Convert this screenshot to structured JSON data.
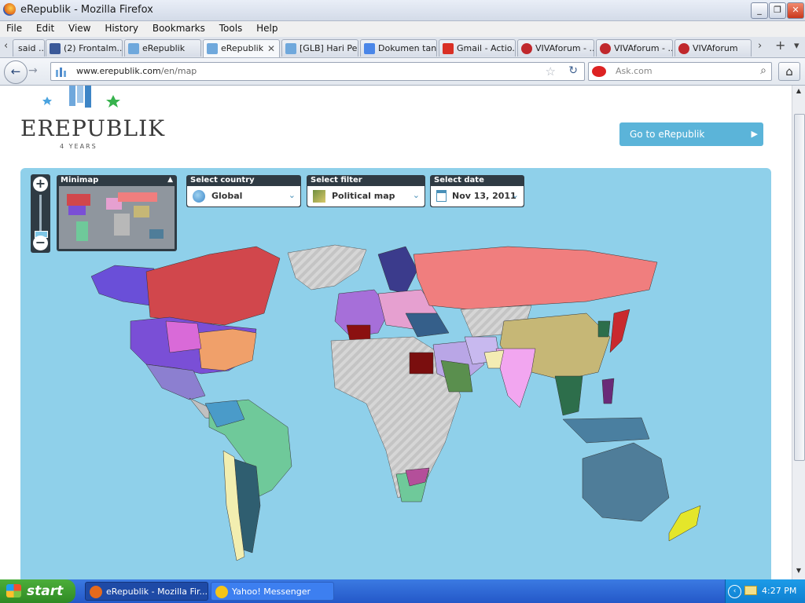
{
  "window": {
    "title": "eRepublik - Mozilla Firefox",
    "minimize": "_",
    "maximize": "❐",
    "close": "✕"
  },
  "menu": [
    "File",
    "Edit",
    "View",
    "History",
    "Bookmarks",
    "Tools",
    "Help"
  ],
  "tabs": [
    {
      "label": "said ...",
      "icon_color": "#c8c8c8"
    },
    {
      "label": "(2) Frontalm...",
      "icon_color": "#3b5998"
    },
    {
      "label": "eRepublik",
      "icon_color": "#6fa8dc"
    },
    {
      "label": "eRepublik",
      "icon_color": "#6fa8dc",
      "active": true
    },
    {
      "label": "[GLB] Hari Pe...",
      "icon_color": "#6fa8dc"
    },
    {
      "label": "Dokumen tan...",
      "icon_color": "#4a86e8"
    },
    {
      "label": "Gmail - Actio...",
      "icon_color": "#d93025"
    },
    {
      "label": "VIVAforum - ...",
      "icon_color": "#c0282c"
    },
    {
      "label": "VIVAforum - ...",
      "icon_color": "#c0282c"
    },
    {
      "label": "VIVAforum",
      "icon_color": "#c0282c"
    }
  ],
  "tab_controls": {
    "scroll_left": "‹",
    "scroll_right": "›",
    "new_tab": "+",
    "list_all": "▾",
    "close_tab": "✕"
  },
  "nav": {
    "back": "←",
    "forward": "→",
    "url_host": "www.erepublik.com",
    "url_path": "/en/map",
    "bookmark_star": "☆",
    "reload": "↻",
    "search_placeholder": "Ask.com",
    "search_icon": "⌕",
    "home": "⌂"
  },
  "page": {
    "logo_text": "EREPUBLIK",
    "logo_sub": "4 YEARS",
    "go_button": "Go to eRepublik",
    "go_chevron": "▶",
    "zoom": {
      "in": "+",
      "out": "−"
    },
    "minimap": {
      "title": "Minimap",
      "collapse": "▲"
    },
    "country_select": {
      "label": "Select country",
      "value": "Global",
      "dropdown": "⌄"
    },
    "filter_select": {
      "label": "Select filter",
      "value": "Political map",
      "dropdown": "⌄"
    },
    "date_select": {
      "label": "Select date",
      "value": "Nov 13, 2011",
      "dropdown": "⌄"
    }
  },
  "colors": {
    "ocean": "#8fd0ea",
    "button": "#5bb4d9",
    "panel": "#2f3b44",
    "accent": "#4890b8"
  },
  "taskbar": {
    "start": "start",
    "tasks": [
      {
        "label": "eRepublik - Mozilla Fir...",
        "active": true,
        "icon_color": "#e66a1c"
      },
      {
        "label": "Yahoo! Messenger",
        "active": false,
        "icon_color": "#f5c518"
      }
    ],
    "tray_chevron": "‹",
    "clock": "4:27 PM"
  },
  "scrollbar": {
    "up": "▲",
    "down": "▼"
  }
}
